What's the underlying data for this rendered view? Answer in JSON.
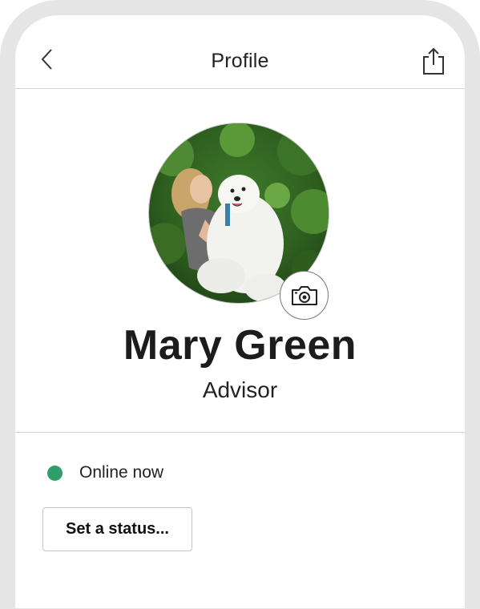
{
  "header": {
    "title": "Profile",
    "back_icon": "chevron-left-icon",
    "share_icon": "share-icon"
  },
  "profile": {
    "name": "Mary Green",
    "role": "Advisor",
    "avatar": "photo of woman holding white dog",
    "camera_icon": "camera-icon"
  },
  "status": {
    "text": "Online now",
    "dot_color": "#2e9e6a",
    "button_label": "Set a status..."
  }
}
